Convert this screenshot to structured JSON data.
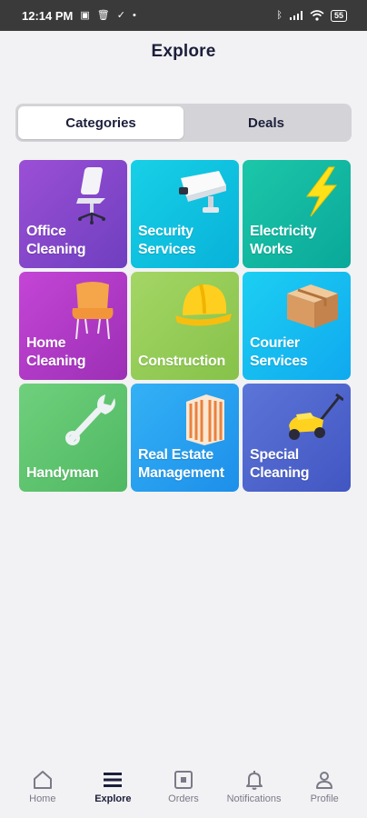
{
  "status_bar": {
    "time": "12:14 PM",
    "battery": "55"
  },
  "header": {
    "title": "Explore"
  },
  "segments": [
    {
      "label": "Categories",
      "active": true
    },
    {
      "label": "Deals",
      "active": false
    }
  ],
  "categories": [
    {
      "label": "Office\nCleaning",
      "icon": "office-chair-icon",
      "color": "#8a47cf"
    },
    {
      "label": "Security\nServices",
      "icon": "security-camera-icon",
      "color": "#10c1df"
    },
    {
      "label": "Electricity\nWorks",
      "icon": "lightning-bolt-icon",
      "color": "#14b8a1"
    },
    {
      "label": "Home\nCleaning",
      "icon": "armchair-icon",
      "color": "#b03ac6"
    },
    {
      "label": "Construction",
      "icon": "hard-hat-icon",
      "color": "#95cc57"
    },
    {
      "label": "Courier\nServices",
      "icon": "parcel-box-icon",
      "color": "#16bcf0"
    },
    {
      "label": "Handyman",
      "icon": "wrench-icon",
      "color": "#5fc46f"
    },
    {
      "label": "Real Estate\nManagement",
      "icon": "building-icon",
      "color": "#28a0ef"
    },
    {
      "label": "Special\nCleaning",
      "icon": "lawn-mower-icon",
      "color": "#4f65cd"
    }
  ],
  "bottom_nav": [
    {
      "label": "Home",
      "icon": "home-icon",
      "active": false
    },
    {
      "label": "Explore",
      "icon": "menu-icon",
      "active": true
    },
    {
      "label": "Orders",
      "icon": "orders-icon",
      "active": false
    },
    {
      "label": "Notifications",
      "icon": "bell-icon",
      "active": false
    },
    {
      "label": "Profile",
      "icon": "person-icon",
      "active": false
    }
  ]
}
